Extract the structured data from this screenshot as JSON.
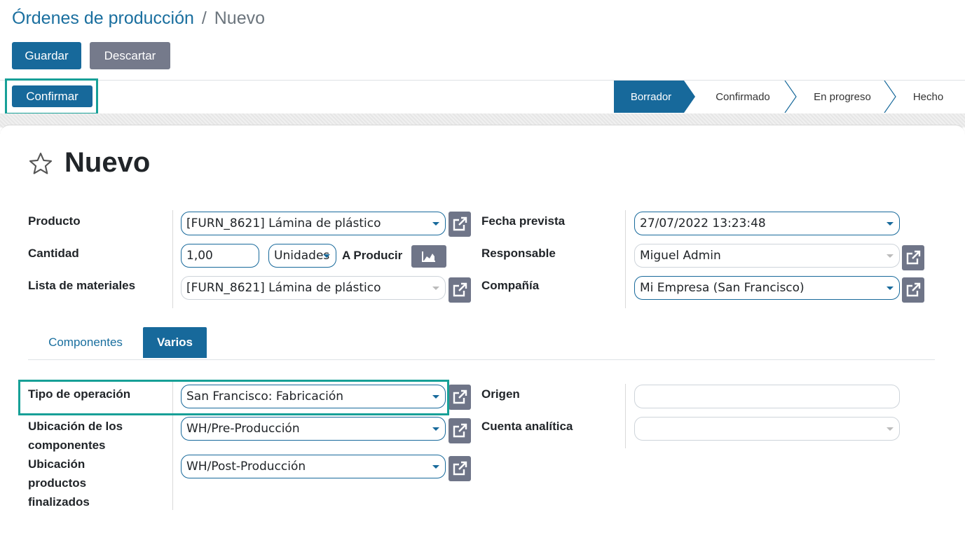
{
  "breadcrumb": {
    "parent": "Órdenes de producción",
    "separator": "/",
    "current": "Nuevo"
  },
  "toolbar": {
    "save_label": "Guardar",
    "discard_label": "Descartar"
  },
  "statusbar": {
    "confirm_label": "Confirmar",
    "stages": [
      "Borrador",
      "Confirmado",
      "En progreso",
      "Hecho"
    ],
    "active_stage": "Borrador"
  },
  "record": {
    "title": "Nuevo",
    "favorite_icon": "star-outline-icon"
  },
  "form": {
    "product_label": "Producto",
    "product_value": "[FURN_8621] Lámina de plástico",
    "quantity_label": "Cantidad",
    "quantity_value": "1,00",
    "uom_value": "Unidades",
    "to_produce_label": "A Producir",
    "bom_label": "Lista de materiales",
    "bom_value": "[FURN_8621] Lámina de plástico",
    "date_label": "Fecha prevista",
    "date_value": "27/07/2022 13:23:48",
    "responsible_label": "Responsable",
    "responsible_value": "Miguel Admin",
    "company_label": "Compañía",
    "company_value": "Mi Empresa (San Francisco)"
  },
  "tabs": [
    {
      "label": "Componentes",
      "active": false
    },
    {
      "label": "Varios",
      "active": true
    }
  ],
  "misc": {
    "optype_label": "Tipo de operación",
    "optype_value": "San Francisco: Fabricación",
    "comp_loc_label_1": "Ubicación de los",
    "comp_loc_label_2": "componentes",
    "comp_loc_value": "WH/Pre-Producción",
    "fin_loc_label_1": "Ubicación",
    "fin_loc_label_2": "productos",
    "fin_loc_label_3": "finalizados",
    "fin_loc_value": "WH/Post-Producción",
    "origin_label": "Origen",
    "origin_value": "",
    "analytic_label": "Cuenta analítica",
    "analytic_value": ""
  },
  "colors": {
    "primary": "#17699b",
    "secondary": "#757a8b",
    "highlight": "#17a097"
  }
}
